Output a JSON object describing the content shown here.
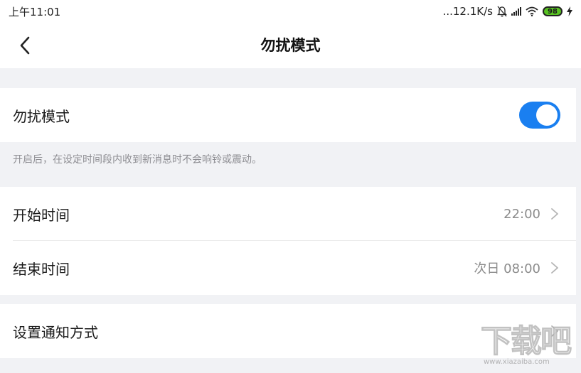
{
  "status_bar": {
    "time": "上午11:01",
    "network_speed": "...12.1K/s",
    "battery": "98",
    "icons": [
      "bell-off-icon",
      "signal-icon",
      "wifi-icon",
      "battery-icon",
      "charging-icon"
    ]
  },
  "nav": {
    "title": "勿扰模式",
    "back_icon": "chevron-left-icon"
  },
  "dnd": {
    "label": "勿扰模式",
    "enabled": true,
    "hint": "开启后，在设定时间段内收到新消息时不会响铃或震动。"
  },
  "schedule": {
    "start_label": "开始时间",
    "start_value": "22:00",
    "end_label": "结束时间",
    "end_value": "次日 08:00"
  },
  "notification": {
    "label": "设置通知方式"
  },
  "colors": {
    "accent": "#1a7ff0",
    "background": "#f1f2f5"
  },
  "watermark": {
    "text": "下载吧",
    "url": "www.xiazaiba.com"
  }
}
